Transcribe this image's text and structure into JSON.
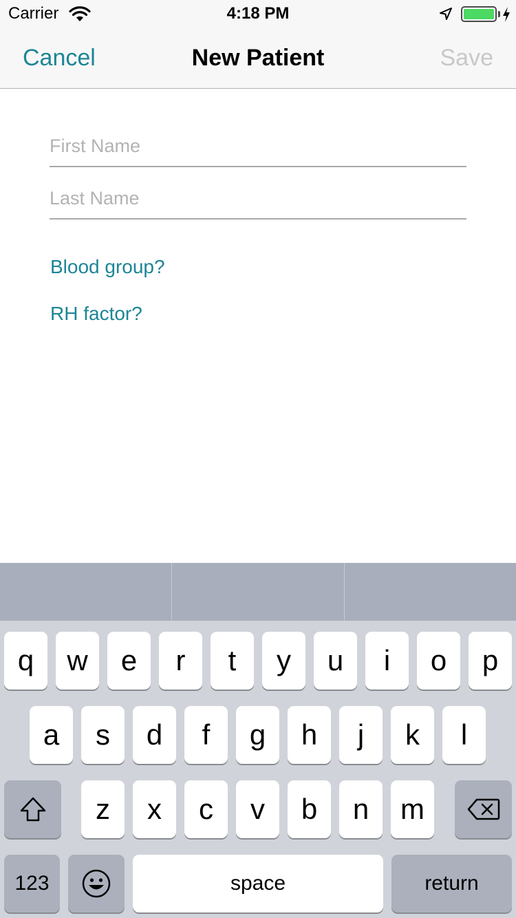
{
  "status_bar": {
    "carrier": "Carrier",
    "time": "4:18 PM",
    "icons": [
      "wifi-icon",
      "location-arrow-icon",
      "battery-icon",
      "charging-bolt-icon"
    ],
    "battery_color": "#4cd964"
  },
  "nav": {
    "cancel": "Cancel",
    "title": "New Patient",
    "save": "Save"
  },
  "form": {
    "first_name_placeholder": "First Name",
    "last_name_placeholder": "Last Name",
    "first_name_value": "",
    "last_name_value": "",
    "blood_group": "Blood group?",
    "rh_factor": "RH factor?"
  },
  "keyboard": {
    "row1": [
      "q",
      "w",
      "e",
      "r",
      "t",
      "y",
      "u",
      "i",
      "o",
      "p"
    ],
    "row2": [
      "a",
      "s",
      "d",
      "f",
      "g",
      "h",
      "j",
      "k",
      "l"
    ],
    "row3": [
      "z",
      "x",
      "c",
      "v",
      "b",
      "n",
      "m"
    ],
    "numbers": "123",
    "space": "space",
    "return": "return",
    "icons": [
      "shift-icon",
      "backspace-icon",
      "emoji-icon"
    ]
  },
  "colors": {
    "accent": "#1d8596",
    "disabled": "#c8c8c8",
    "keyboard_bg": "#d0d3d9",
    "dark_key": "#abb0bc"
  }
}
